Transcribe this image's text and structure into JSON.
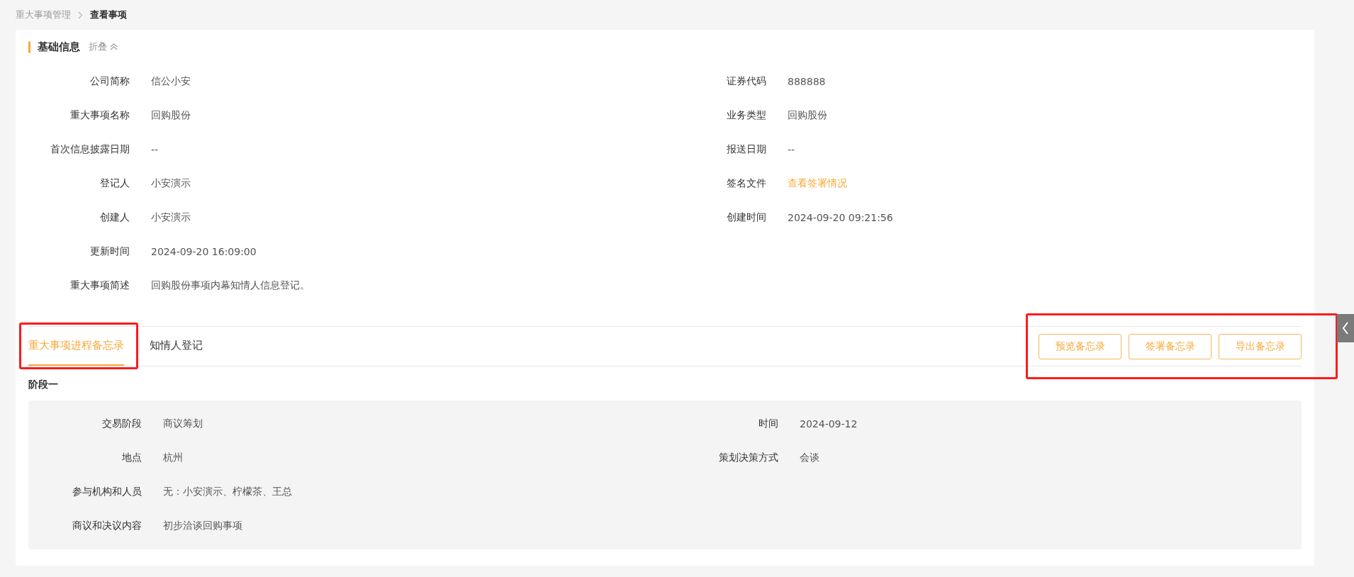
{
  "breadcrumb": [
    {
      "label": "重大事项管理",
      "current": false
    },
    {
      "label": "查看事项",
      "current": true
    }
  ],
  "basic_info": {
    "title": "基础信息",
    "collapse_label": "折叠",
    "expanded": true,
    "fields": [
      {
        "label": "公司简称",
        "value": "信公小安",
        "kind": "text",
        "wide": false
      },
      {
        "label": "证券代码",
        "value": "888888",
        "kind": "text",
        "wide": false
      },
      {
        "label": "重大事项名称",
        "value": "回购股份",
        "kind": "text",
        "wide": false
      },
      {
        "label": "业务类型",
        "value": "回购股份",
        "kind": "text",
        "wide": false
      },
      {
        "label": "首次信息披露日期",
        "value": "--",
        "kind": "text",
        "wide": false
      },
      {
        "label": "报送日期",
        "value": "--",
        "kind": "text",
        "wide": false
      },
      {
        "label": "登记人",
        "value": "小安演示",
        "kind": "text",
        "wide": false
      },
      {
        "label": "签名文件",
        "value": "查看签署情况",
        "kind": "link",
        "wide": false
      },
      {
        "label": "创建人",
        "value": "小安演示",
        "kind": "text",
        "wide": false
      },
      {
        "label": "创建时间",
        "value": "2024-09-20 09:21:56",
        "kind": "text",
        "wide": false
      },
      {
        "label": "更新时间",
        "value": "2024-09-20 16:09:00",
        "kind": "text",
        "wide": false
      },
      {
        "label": "重大事项简述",
        "value": "回购股份事项内幕知情人信息登记。",
        "kind": "text",
        "wide": true
      }
    ]
  },
  "tab_bar": {
    "highlighted": true,
    "tabs": [
      {
        "label": "重大事项进程备忘录",
        "selected": true
      },
      {
        "label": "知情人登记",
        "selected": false
      }
    ]
  },
  "actions": {
    "highlighted": true,
    "buttons": [
      "预览备忘录",
      "签署备忘录",
      "导出备忘录"
    ]
  },
  "stage": {
    "title": "阶段一",
    "fields": [
      {
        "label": "交易阶段",
        "value": "商议筹划",
        "wide": false
      },
      {
        "label": "时间",
        "value": "2024-09-12",
        "wide": false
      },
      {
        "label": "地点",
        "value": "杭州",
        "wide": false
      },
      {
        "label": "策划决策方式",
        "value": "会谈",
        "wide": false
      },
      {
        "label": "参与机构和人员",
        "value": "无：小安演示、柠檬茶、王总",
        "wide": true
      },
      {
        "label": "商议和决议内容",
        "value": "初步洽谈回购事项",
        "wide": true
      }
    ]
  }
}
